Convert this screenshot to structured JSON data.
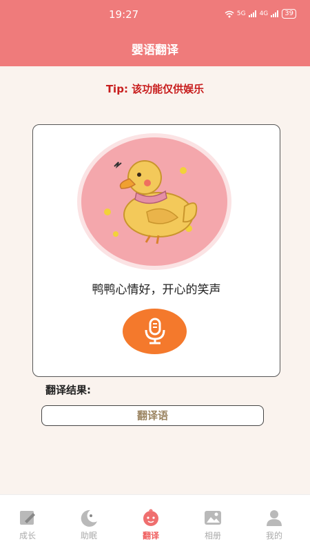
{
  "status_bar": {
    "time": "19:27",
    "network_1": "5G",
    "network_2": "4G",
    "battery": "39"
  },
  "header": {
    "title": "婴语翻译"
  },
  "tip": "Tip: 该功能仅供娱乐",
  "card": {
    "status_text": "鸭鸭心情好，开心的笑声",
    "mic_icon": "microphone-icon"
  },
  "result": {
    "label": "翻译结果:",
    "value": "翻译语"
  },
  "tabs": [
    {
      "label": "成长",
      "icon": "pencil-note-icon",
      "active": false
    },
    {
      "label": "助眠",
      "icon": "moon-icon",
      "active": false
    },
    {
      "label": "翻译",
      "icon": "baby-face-icon",
      "active": true
    },
    {
      "label": "相册",
      "icon": "image-icon",
      "active": false
    },
    {
      "label": "我的",
      "icon": "person-icon",
      "active": false
    }
  ],
  "colors": {
    "header": "#ef7b7b",
    "tip": "#c81e1e",
    "mic": "#f4792c",
    "circle": "#f4a7ac",
    "active_tab": "#ef5c5c"
  }
}
